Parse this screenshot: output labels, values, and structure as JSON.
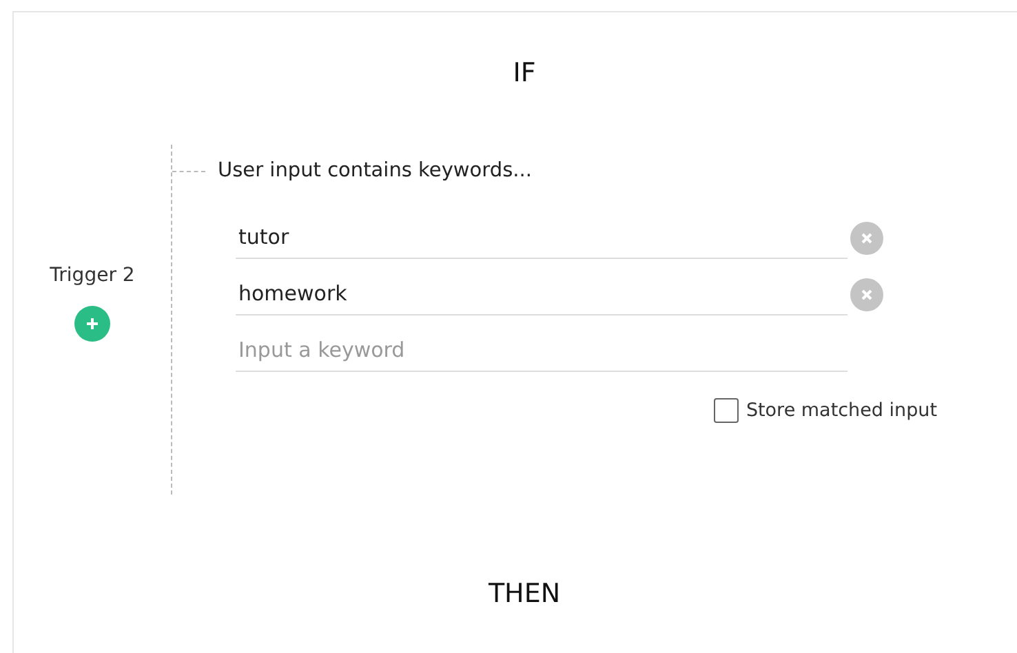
{
  "if_heading": "IF",
  "trigger": {
    "label": "Trigger 2",
    "condition": "User input contains keywords...",
    "keywords": [
      {
        "value": "tutor"
      },
      {
        "value": "homework"
      }
    ],
    "new_keyword": {
      "placeholder": "Input a keyword"
    },
    "store_matched": {
      "label": "Store matched input",
      "checked": false
    }
  },
  "then_heading": "THEN"
}
